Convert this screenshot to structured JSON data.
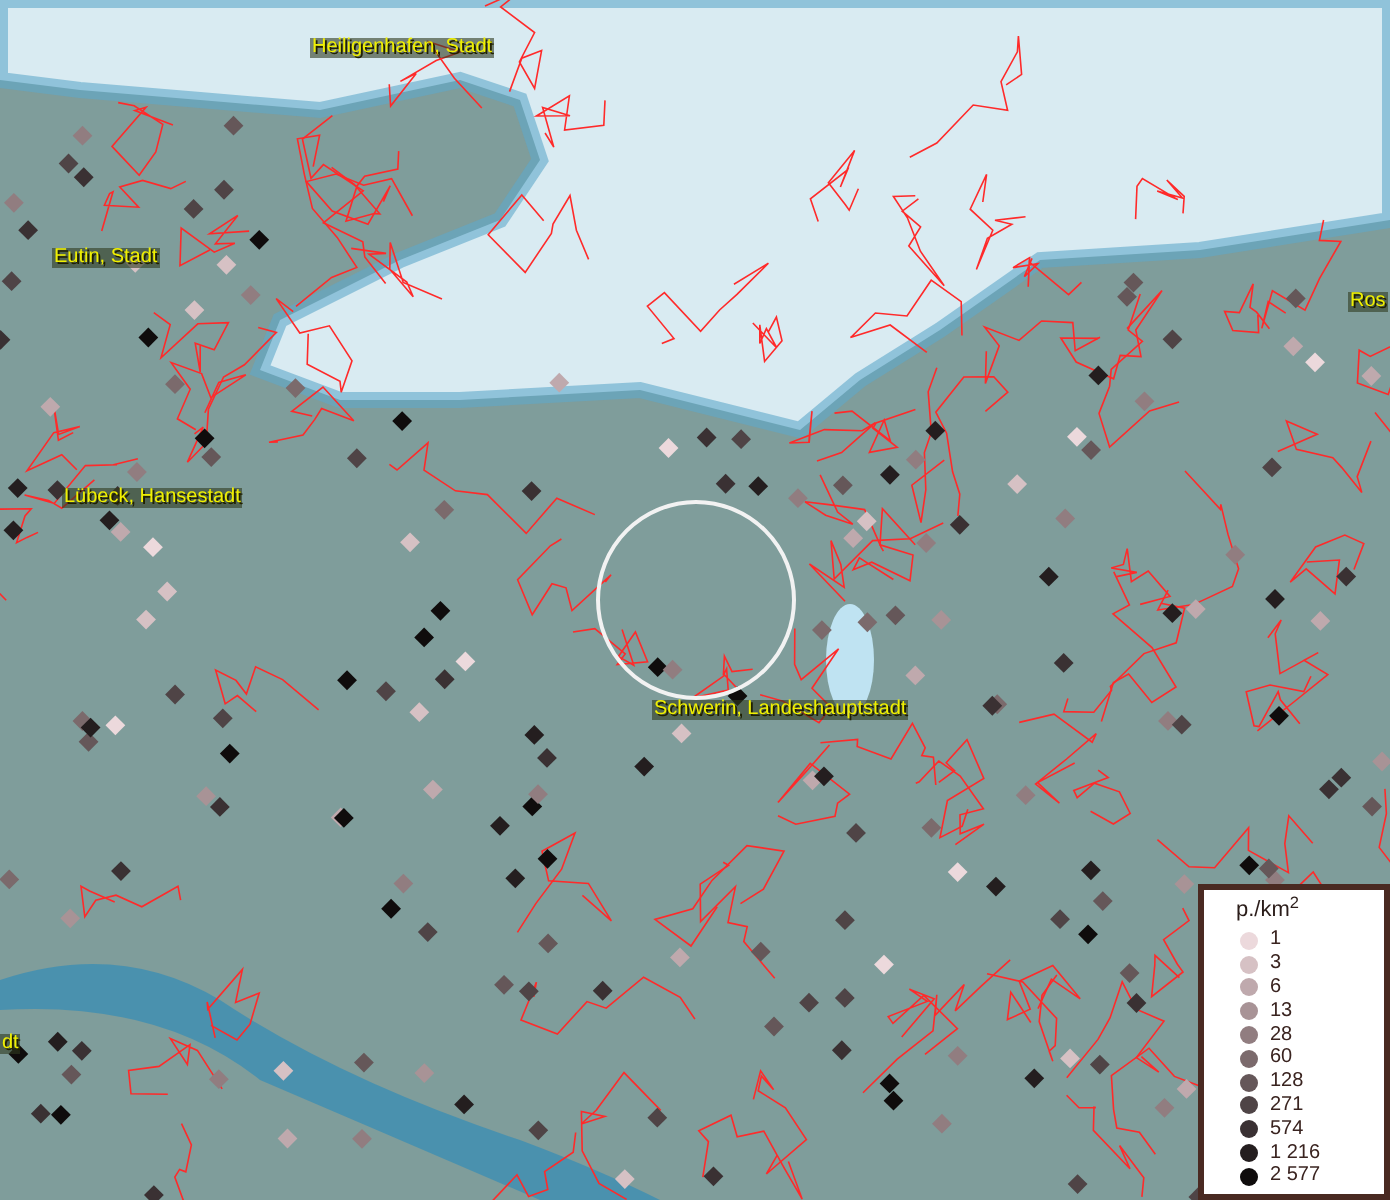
{
  "map": {
    "place_labels": [
      {
        "text": "Heiligenhafen, Stadt"
      },
      {
        "text": "Eutin, Stadt"
      },
      {
        "text": "Lübeck, Hansestadt"
      },
      {
        "text": "Schwerin, Landeshauptstadt"
      },
      {
        "text": "Ros"
      },
      {
        "text": "dt"
      }
    ]
  },
  "legend": {
    "title": "p./km$^{2}$",
    "items": [
      {
        "label": "1",
        "color": "#ecd9dc"
      },
      {
        "label": "3",
        "color": "#d6c1c4"
      },
      {
        "label": "6",
        "color": "#bfa9ad"
      },
      {
        "label": "13",
        "color": "#a89396"
      },
      {
        "label": "28",
        "color": "#917d80"
      },
      {
        "label": "60",
        "color": "#7b6a6c"
      },
      {
        "label": "128",
        "color": "#655759"
      },
      {
        "label": "271",
        "color": "#4f4446"
      },
      {
        "label": "574",
        "color": "#3a3133"
      },
      {
        "label": "1 216",
        "color": "#241e1f"
      },
      {
        "label": "2 577",
        "color": "#0f0c0c"
      }
    ]
  }
}
